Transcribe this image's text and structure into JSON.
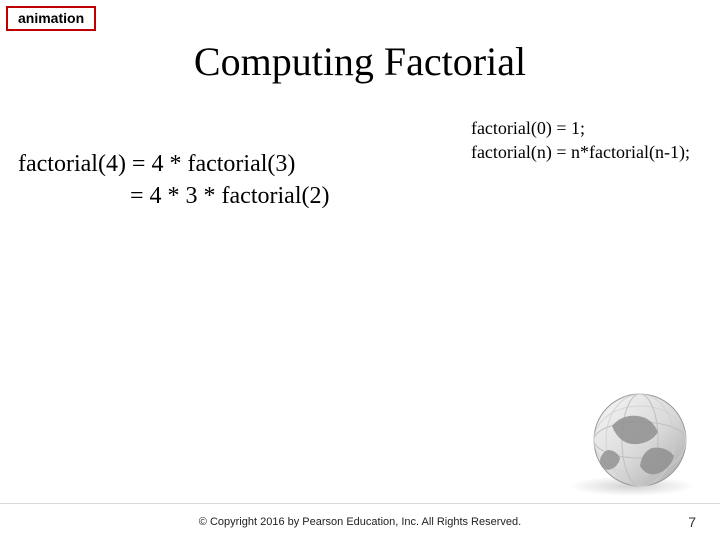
{
  "badge": {
    "label": "animation"
  },
  "title": "Computing Factorial",
  "derivation": {
    "line1": "factorial(4) = 4 * factorial(3)",
    "line2_lhs_pad": "",
    "line2": "= 4 * 3 * factorial(2)"
  },
  "defs": {
    "base": "factorial(0) = 1;",
    "rec": "factorial(n) = n*factorial(n-1);"
  },
  "footer": {
    "copyright": "© Copyright 2016 by Pearson Education, Inc. All Rights Reserved.",
    "page": "7"
  }
}
